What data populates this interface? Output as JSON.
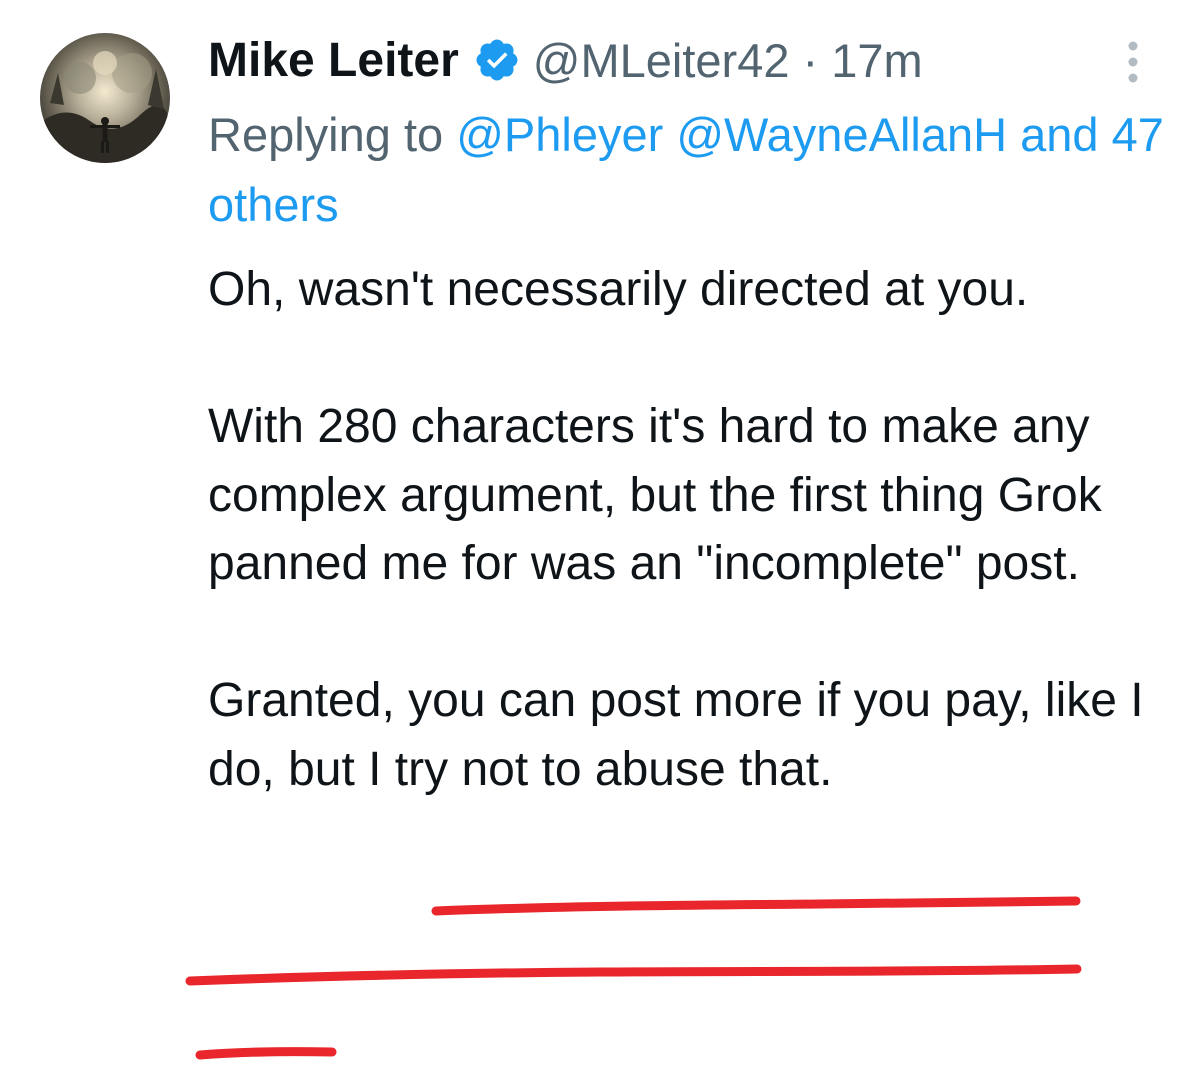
{
  "author": {
    "name": "Mike Leiter",
    "handle": "@MLeiter42",
    "separator": "·",
    "time": "17m",
    "verified": true
  },
  "reply": {
    "prefix": "Replying to",
    "mentions": [
      "@Phleyer",
      "@WayneAllanH"
    ],
    "others": "and 47 others"
  },
  "tweet": {
    "para1": "Oh, wasn't necessarily directed at you.",
    "para2": "With 280 characters it's hard to make any complex argument, but the first thing Grok panned me for was an \"incomplete\" post.",
    "para3_prefix": "Granted,",
    "para3_highlight": "you can post more if you pay, like I do, but I try not to abuse that."
  },
  "colors": {
    "text": "#0f1419",
    "secondary": "#536471",
    "link": "#1d9bf0",
    "verified_badge": "#1d9bf0",
    "annotation_underline": "#e8262b"
  },
  "icons": {
    "verified": "verified-badge-icon",
    "more": "more-vertical-icon"
  }
}
